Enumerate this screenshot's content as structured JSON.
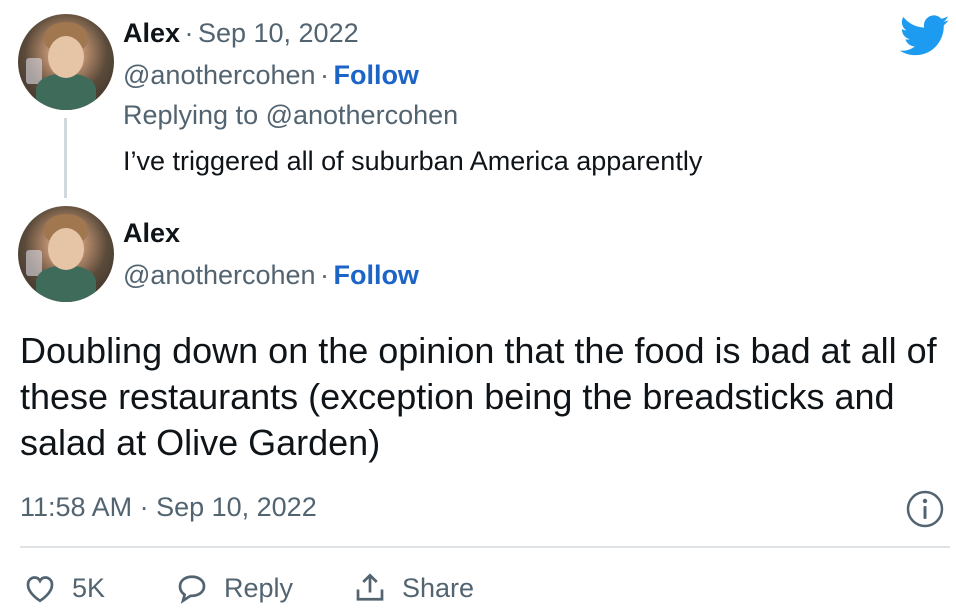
{
  "parent_tweet": {
    "author_name": "Alex",
    "separator": "·",
    "date": "Sep 10, 2022",
    "handle": "@anothercohen",
    "follow_label": "Follow",
    "replying_to": "Replying to @anothercohen",
    "text": "I’ve triggered all of suburban America apparently"
  },
  "main_tweet": {
    "author_name": "Alex",
    "handle": "@anothercohen",
    "separator": "·",
    "follow_label": "Follow",
    "text": "Doubling down on the opinion that the food is bad at all of these restaurants (exception being the breadsticks and salad at Olive Garden)",
    "timestamp": "11:58 AM · Sep 10, 2022"
  },
  "actions": {
    "likes_count": "5K",
    "reply_label": "Reply",
    "share_label": "Share"
  },
  "icons": {
    "brand": "twitter-bird-icon",
    "info": "info-icon",
    "like": "heart-icon",
    "reply": "speech-bubble-icon",
    "share": "share-icon"
  },
  "colors": {
    "twitter_blue": "#1d9bf0",
    "follow_blue": "#1d64c7",
    "muted_text": "#536471",
    "text": "#0f1419"
  }
}
